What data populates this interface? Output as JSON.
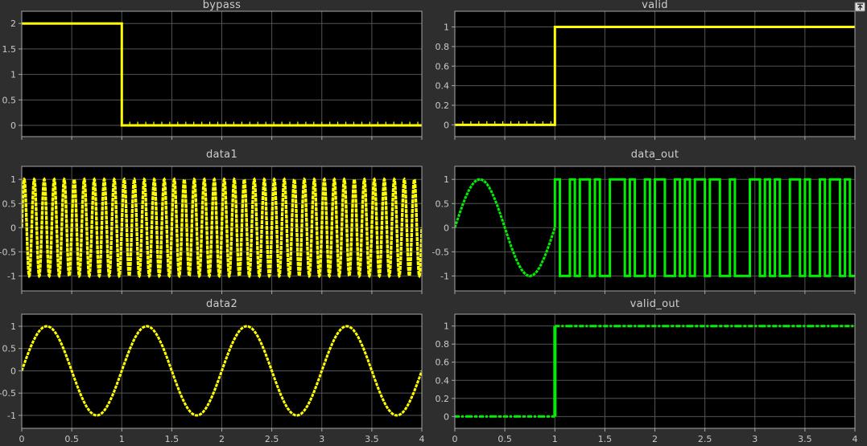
{
  "style": {
    "figure_bg": "#2e2e2e",
    "plot_bg": "#000000",
    "grid_color": "#545454",
    "border_color": "#a6a6a6",
    "text_color": "#c9c9c9",
    "yellow": "#ffff00",
    "green": "#00ee00"
  },
  "icons": {
    "undock": "pop-out-arrow"
  },
  "chart_data": [
    {
      "type": "line",
      "title": "bypass",
      "series_color": "#ffff00",
      "grid": true,
      "legend": "none",
      "xlim": [
        0,
        4
      ],
      "ylim": [
        -0.22,
        2.24
      ],
      "xtick_values": [
        0,
        0.5,
        1,
        1.5,
        2,
        2.5,
        3,
        3.5,
        4
      ],
      "xtick_labels": [],
      "ytick_values": [
        0,
        0.5,
        1,
        1.5,
        2
      ],
      "ytick_labels": [
        "0",
        "0.5",
        "1",
        "1.5",
        "2"
      ],
      "signal": {
        "kind": "step",
        "step_time": 1,
        "level_before": 2,
        "level_after": 0,
        "line_width": 3,
        "sample_ticks": {
          "from": 1,
          "to": 4,
          "interval": 0.08,
          "level": 0
        }
      }
    },
    {
      "type": "line",
      "title": "valid",
      "series_color": "#ffff00",
      "grid": true,
      "legend": "none",
      "xlim": [
        0,
        4
      ],
      "ylim": [
        -0.12,
        1.16
      ],
      "xtick_values": [
        0,
        0.5,
        1,
        1.5,
        2,
        2.5,
        3,
        3.5,
        4
      ],
      "xtick_labels": [],
      "ytick_values": [
        0,
        0.2,
        0.4,
        0.6,
        0.8,
        1
      ],
      "ytick_labels": [
        "0",
        "0.2",
        "0.4",
        "0.6",
        "0.8",
        "1"
      ],
      "signal": {
        "kind": "step",
        "step_time": 1,
        "level_before": 0,
        "level_after": 1,
        "line_width": 3,
        "sample_ticks": {
          "from": 0,
          "to": 1,
          "interval": 0.08,
          "level": 0
        }
      }
    },
    {
      "type": "line",
      "title": "data1",
      "series_color": "#ffff00",
      "grid": true,
      "legend": "none",
      "xlim": [
        0,
        4
      ],
      "ylim": [
        -1.31,
        1.27
      ],
      "xtick_values": [
        0,
        0.5,
        1,
        1.5,
        2,
        2.5,
        3,
        3.5,
        4
      ],
      "xtick_labels": [],
      "ytick_values": [
        -1,
        -0.5,
        0,
        0.5,
        1
      ],
      "ytick_labels": [
        "-1",
        "-0.5",
        "0",
        "0.5",
        "1"
      ],
      "signal": {
        "kind": "sine",
        "amplitude": 1,
        "frequency": 10,
        "phase": 0,
        "t_start": 0,
        "t_end": 4,
        "line_width": 3.4,
        "dash": "5 1"
      }
    },
    {
      "type": "line",
      "title": "data_out",
      "series_color": "#00ee00",
      "grid": true,
      "legend": "none",
      "xlim": [
        0,
        4
      ],
      "ylim": [
        -1.31,
        1.27
      ],
      "xtick_values": [
        0,
        0.5,
        1,
        1.5,
        2,
        2.5,
        3,
        3.5,
        4
      ],
      "xtick_labels": [],
      "ytick_values": [
        -1,
        -0.5,
        0,
        0.5,
        1
      ],
      "ytick_labels": [
        "-1",
        "-0.5",
        "0",
        "0.5",
        "1"
      ],
      "signal": {
        "kind": "sine_then_chips",
        "sine": {
          "amplitude": 1,
          "frequency": 1,
          "phase": 0,
          "t_start": 0,
          "t_end": 1,
          "line_width": 3,
          "dash": "3.5 1.3"
        },
        "chips": {
          "t_start": 1,
          "chip_period": 0.05,
          "line_width": 3,
          "values": [
            1,
            -1,
            -1,
            1,
            -1,
            1,
            1,
            -1,
            1,
            -1,
            -1,
            1,
            1,
            1,
            -1,
            1,
            -1,
            -1,
            1,
            -1,
            1,
            1,
            -1,
            -1,
            1,
            -1,
            1,
            -1,
            1,
            1,
            -1,
            1,
            1,
            -1,
            -1,
            1,
            -1,
            -1,
            -1,
            1,
            1,
            -1,
            1,
            -1,
            1,
            -1,
            -1,
            1,
            1,
            -1,
            1,
            -1,
            -1,
            1,
            -1,
            1,
            1,
            -1,
            1,
            -1
          ]
        }
      }
    },
    {
      "type": "line",
      "title": "data2",
      "series_color": "#ffff00",
      "grid": true,
      "legend": "none",
      "xlim": [
        0,
        4
      ],
      "ylim": [
        -1.29,
        1.27
      ],
      "xtick_values": [
        0,
        0.5,
        1,
        1.5,
        2,
        2.5,
        3,
        3.5,
        4
      ],
      "xtick_labels": [
        "0",
        "0.5",
        "1",
        "1.5",
        "2",
        "2.5",
        "3",
        "3.5",
        "4"
      ],
      "ytick_values": [
        -1,
        -0.5,
        0,
        0.5,
        1
      ],
      "ytick_labels": [
        "-1",
        "-0.5",
        "0",
        "0.5",
        "1"
      ],
      "signal": {
        "kind": "sine",
        "amplitude": 1,
        "frequency": 1,
        "phase": 0,
        "t_start": 0,
        "t_end": 4,
        "line_width": 3,
        "dash": "4 1.2"
      }
    },
    {
      "type": "line",
      "title": "valid_out",
      "series_color": "#00ee00",
      "grid": true,
      "legend": "none",
      "xlim": [
        0,
        4
      ],
      "ylim": [
        -0.13,
        1.13
      ],
      "xtick_values": [
        0,
        0.5,
        1,
        1.5,
        2,
        2.5,
        3,
        3.5,
        4
      ],
      "xtick_labels": [
        "0",
        "0.5",
        "1",
        "1.5",
        "2",
        "2.5",
        "3",
        "3.5",
        "4"
      ],
      "ytick_values": [
        0,
        0.2,
        0.4,
        0.6,
        0.8,
        1
      ],
      "ytick_labels": [
        "0",
        "0.2",
        "0.4",
        "0.6",
        "0.8",
        "1"
      ],
      "signal": {
        "kind": "step",
        "step_time": 1,
        "level_before": 0,
        "level_after": 1,
        "dashed": true,
        "dash": "6 2 3 2 9 2 4 2",
        "line_width": 3,
        "rise_width": 4
      }
    }
  ]
}
